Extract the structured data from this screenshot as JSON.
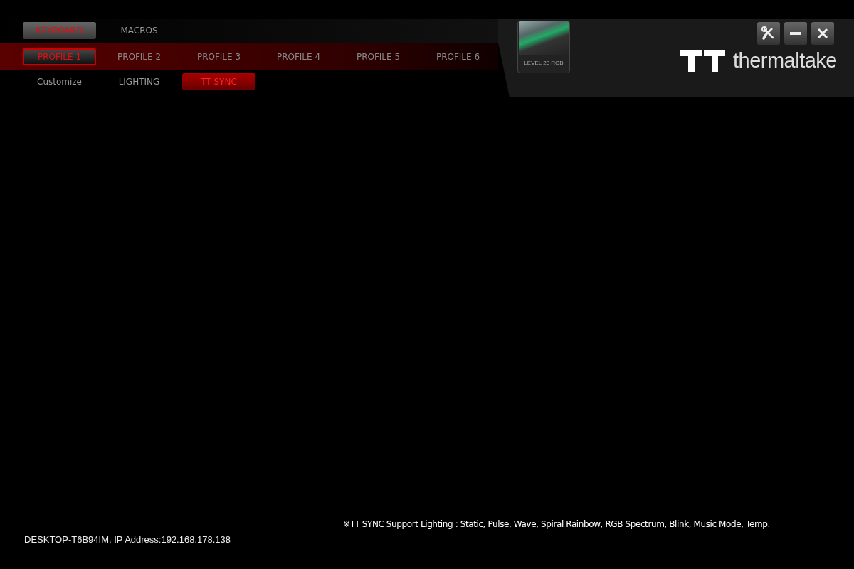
{
  "main_tabs": [
    {
      "label": "KEYBOARD",
      "selected": true
    },
    {
      "label": "MACROS",
      "selected": false
    }
  ],
  "profile_tabs": [
    {
      "label": "PROFILE 1",
      "selected": true
    },
    {
      "label": "PROFILE 2",
      "selected": false
    },
    {
      "label": "PROFILE 3",
      "selected": false
    },
    {
      "label": "PROFILE 4",
      "selected": false
    },
    {
      "label": "PROFILE 5",
      "selected": false
    },
    {
      "label": "PROFILE 6",
      "selected": false
    }
  ],
  "sub_tabs": [
    {
      "label": "Customize",
      "selected": false
    },
    {
      "label": "LIGHTING",
      "selected": false
    },
    {
      "label": "TT SYNC",
      "selected": true
    }
  ],
  "device": {
    "name": "LEVEL 20 RGB"
  },
  "window_buttons": [
    {
      "kind": "settings"
    },
    {
      "kind": "minimize"
    },
    {
      "kind": "close"
    }
  ],
  "logo": {
    "text": "thermaltake"
  },
  "status": {
    "host": "DESKTOP-T6B94IM, IP Address:192.168.178.138",
    "note": "※TT SYNC Support Lighting : Static, Pulse, Wave, Spiral Rainbow, RGB Spectrum, Blink, Music Mode, Temp."
  }
}
